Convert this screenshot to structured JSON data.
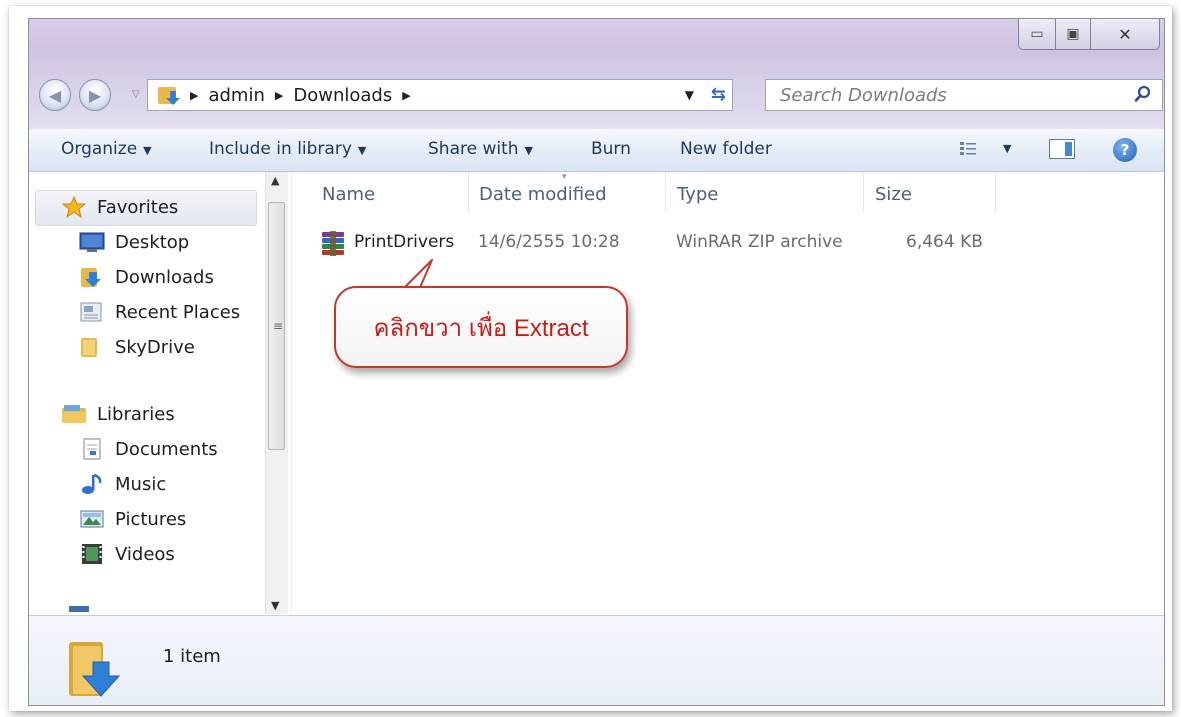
{
  "window": {
    "caption": {
      "minimize": "▭",
      "maximize": "▣",
      "close": "✕"
    }
  },
  "address": {
    "segments": [
      "admin",
      "Downloads"
    ],
    "search_placeholder": "Search Downloads"
  },
  "toolbar": {
    "organize": "Organize",
    "include_in_library": "Include in library",
    "share_with": "Share with",
    "burn": "Burn",
    "new_folder": "New folder"
  },
  "navigation": {
    "favorites": {
      "label": "Favorites",
      "items": [
        "Desktop",
        "Downloads",
        "Recent Places",
        "SkyDrive"
      ]
    },
    "libraries": {
      "label": "Libraries",
      "items": [
        "Documents",
        "Music",
        "Pictures",
        "Videos"
      ]
    }
  },
  "columns": {
    "name": "Name",
    "date_modified": "Date modified",
    "type": "Type",
    "size": "Size"
  },
  "files": [
    {
      "name": "PrintDrivers",
      "date_modified": "14/6/2555 10:28",
      "type": "WinRAR ZIP archive",
      "size": "6,464 KB"
    }
  ],
  "callout": {
    "text": "คลิกขวา เพื่อ Extract"
  },
  "details": {
    "count": "1 item"
  },
  "colors": {
    "callout_border": "#c0392b",
    "callout_text": "#c0201a",
    "link_text": "#1e395b"
  }
}
